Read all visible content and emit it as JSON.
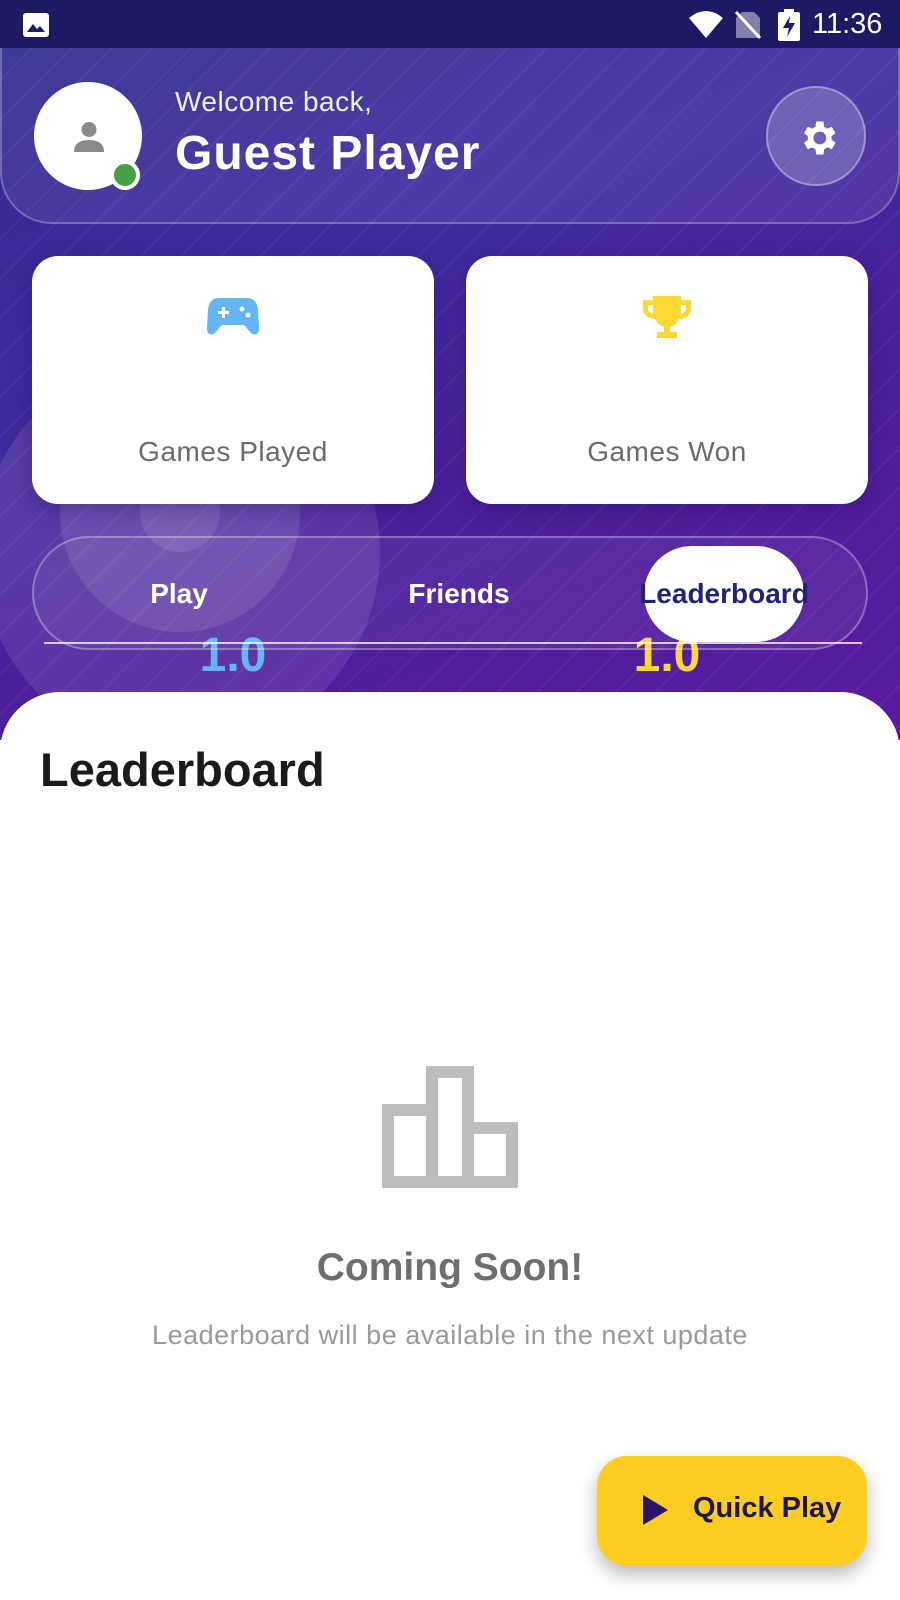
{
  "status_bar": {
    "time": "11:36",
    "icons": [
      "gallery-icon",
      "wifi-icon",
      "no-sim-icon",
      "battery-charging-icon"
    ]
  },
  "header": {
    "welcome": "Welcome back,",
    "player_name": "Guest Player",
    "avatar_icon": "person-icon",
    "online_status_color": "#43a047",
    "settings_icon": "gear-icon"
  },
  "stats": [
    {
      "icon": "gamepad-icon",
      "value": "1.0",
      "label": "Games Played",
      "color": "#64b5f6"
    },
    {
      "icon": "trophy-icon",
      "value": "1.0",
      "label": "Games Won",
      "color": "#fdd835"
    }
  ],
  "tabs": [
    {
      "label": "Play",
      "selected": false
    },
    {
      "label": "Friends",
      "selected": false
    },
    {
      "label": "Leaderboard",
      "selected": true
    }
  ],
  "content": {
    "title": "Leaderboard",
    "empty_icon": "leaderboard-icon",
    "empty_title": "Coming Soon!",
    "empty_subtitle": "Leaderboard will be available in the next update"
  },
  "fab": {
    "icon": "play-icon",
    "label": "Quick Play",
    "color": "#ffcd1f"
  }
}
